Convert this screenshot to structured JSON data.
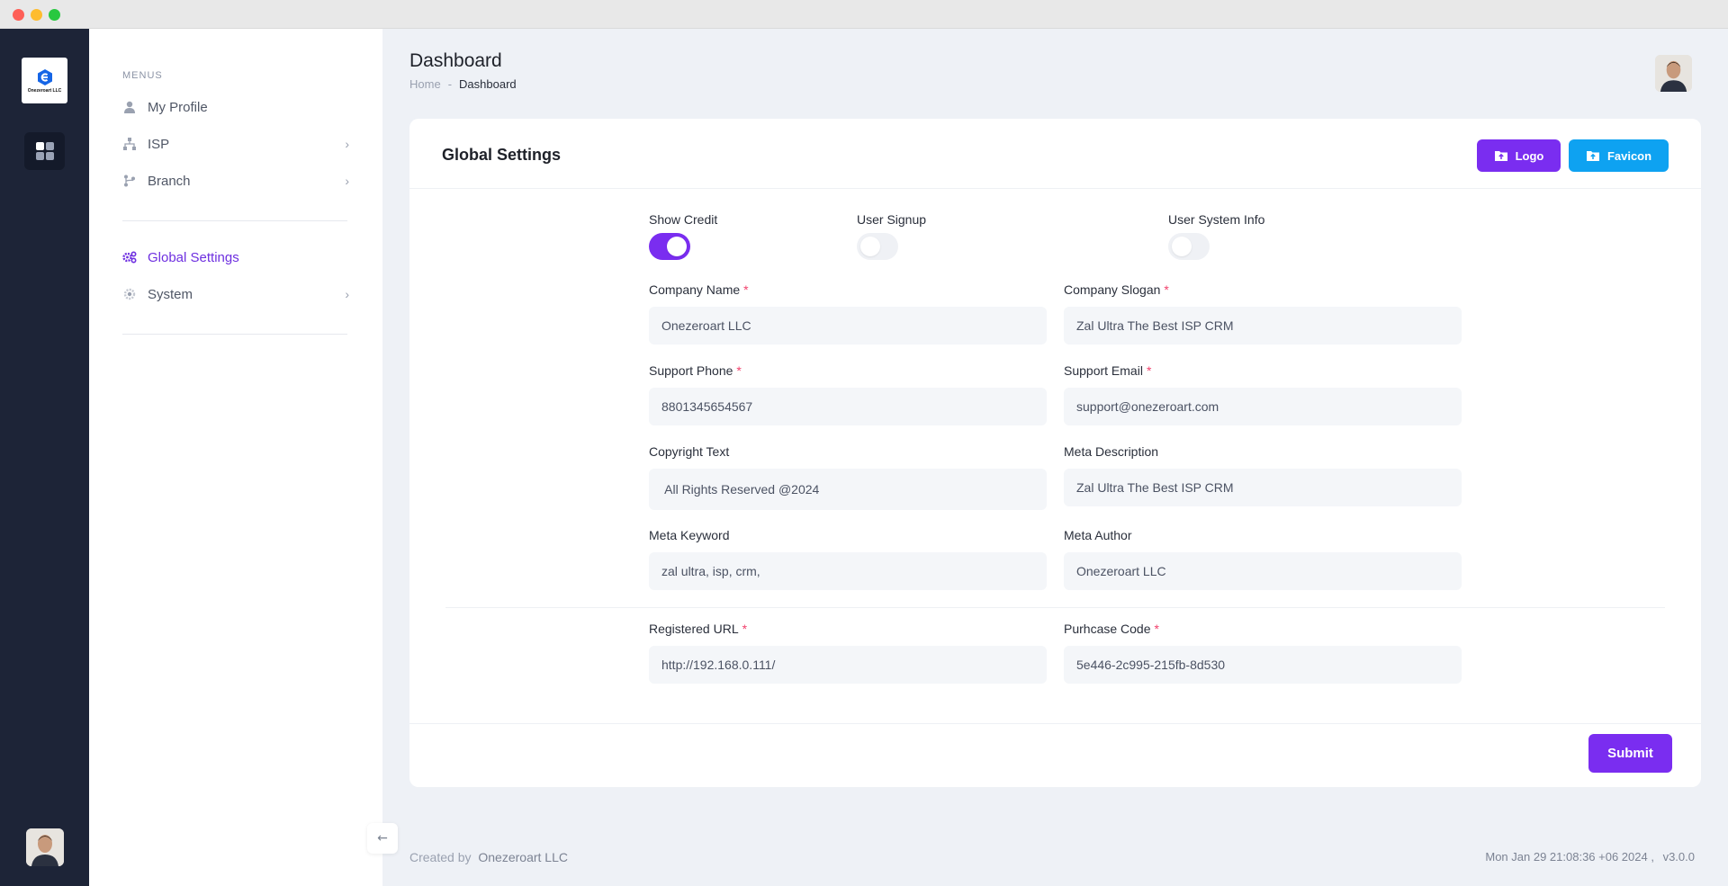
{
  "menu": {
    "heading": "MENUS",
    "items": [
      {
        "label": "My Profile",
        "icon": "user-icon"
      },
      {
        "label": "ISP",
        "icon": "network-icon"
      },
      {
        "label": "Branch",
        "icon": "branch-icon"
      },
      {
        "label": "Global Settings",
        "icon": "gears-icon"
      },
      {
        "label": "System",
        "icon": "cog-icon"
      }
    ]
  },
  "brand": {
    "logo_text": "Onezeroart LLC",
    "accent": "#7a2df0",
    "sky": "#0ea2f1"
  },
  "header": {
    "title": "Dashboard",
    "breadcrumb": {
      "home": "Home",
      "sep": "-",
      "current": "Dashboard"
    }
  },
  "card": {
    "title": "Global Settings",
    "logo_btn": "Logo",
    "favicon_btn": "Favicon",
    "toggles": {
      "show_credit": {
        "label": "Show Credit",
        "on": true
      },
      "user_signup": {
        "label": "User Signup",
        "on": false
      },
      "user_system_info": {
        "label": "User System Info",
        "on": false
      }
    },
    "fields": {
      "company_name": {
        "label": "Company Name",
        "value": "Onezeroart LLC"
      },
      "company_slogan": {
        "label": "Company Slogan",
        "value": "Zal Ultra The Best ISP CRM"
      },
      "support_phone": {
        "label": "Support Phone",
        "value": "8801345654567"
      },
      "support_email": {
        "label": "Support Email",
        "value": "support@onezeroart.com"
      },
      "copyright_text": {
        "label": "Copyright Text",
        "value": " All Rights Reserved @2024"
      },
      "meta_description": {
        "label": "Meta Description",
        "value": "Zal Ultra The Best ISP CRM"
      },
      "meta_keyword": {
        "label": "Meta Keyword",
        "value": "zal ultra, isp, crm,"
      },
      "meta_author": {
        "label": "Meta Author",
        "value": "Onezeroart LLC"
      },
      "registered_url": {
        "label": "Registered URL",
        "value": "http://192.168.0.111/"
      },
      "purchase_code": {
        "label": "Purhcase Code",
        "value": "5e446-2c995-215fb-8d530"
      }
    },
    "required_mark": "*",
    "submit": "Submit"
  },
  "footer": {
    "created_by": "Created by",
    "company": "Onezeroart LLC",
    "datetime": "Mon Jan 29 21:08:36 +06 2024 ,",
    "version": "v3.0.0"
  }
}
